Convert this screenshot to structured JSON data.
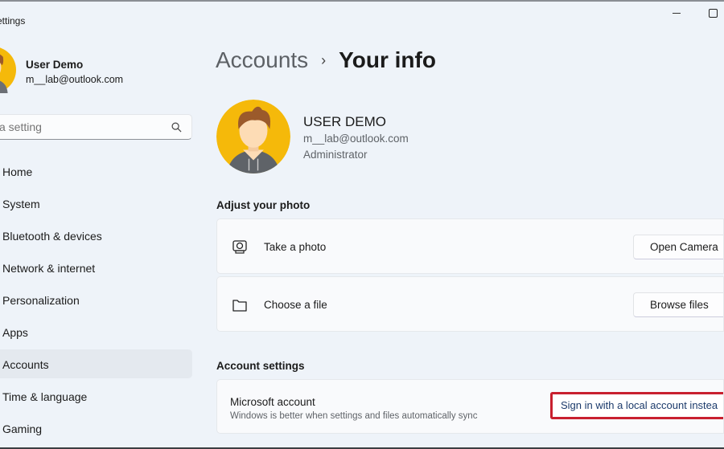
{
  "window": {
    "title": "Settings",
    "title_visible": "ettings"
  },
  "user": {
    "name": "User Demo",
    "email": "m__lab@outlook.com"
  },
  "search": {
    "placeholder": "a setting",
    "icon": "search-icon"
  },
  "sidebar": {
    "items": [
      {
        "label": "Home"
      },
      {
        "label": "System"
      },
      {
        "label": "Bluetooth & devices"
      },
      {
        "label": "Network & internet"
      },
      {
        "label": "Personalization"
      },
      {
        "label": "Apps"
      },
      {
        "label": "Accounts",
        "active": true
      },
      {
        "label": "Time & language"
      },
      {
        "label": "Gaming"
      }
    ]
  },
  "breadcrumb": {
    "parent": "Accounts",
    "separator": "›",
    "current": "Your info"
  },
  "profile": {
    "name": "USER DEMO",
    "email": "m__lab@outlook.com",
    "role": "Administrator"
  },
  "photo": {
    "section_title": "Adjust your photo",
    "take_photo": {
      "label": "Take a photo",
      "button": "Open Camera",
      "icon": "camera-icon"
    },
    "choose_file": {
      "label": "Choose a file",
      "button": "Browse files",
      "icon": "folder-icon"
    }
  },
  "account_settings": {
    "section_title": "Account settings",
    "microsoft": {
      "title": "Microsoft account",
      "subtitle": "Windows is better when settings and files automatically sync",
      "button": "Sign in with a local account instea"
    }
  },
  "colors": {
    "background": "#eef3f9",
    "highlight": "#c8202f",
    "avatar_bg": "#f5b90a"
  }
}
